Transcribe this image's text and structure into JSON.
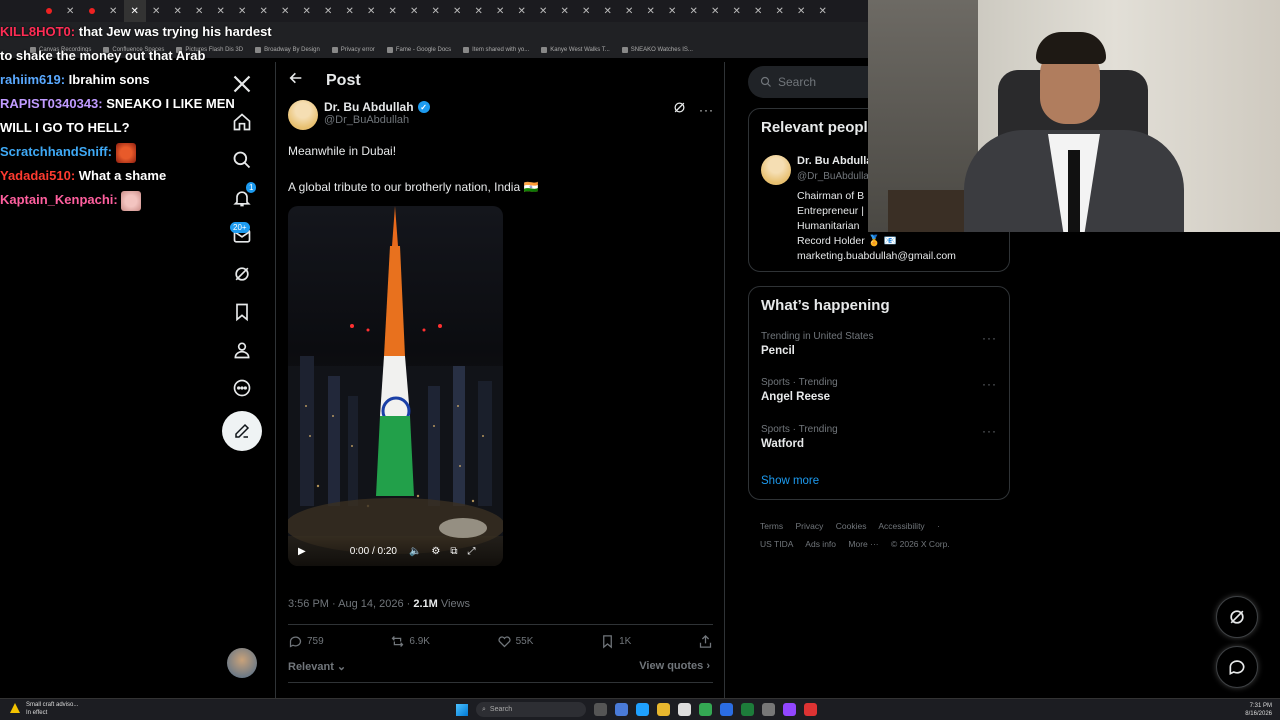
{
  "browser": {
    "bookmarks": [
      "Canvas Recordings",
      "Confluence Spaces",
      "Pictures Flash Dis 3D",
      "Broadway By Design",
      "Privacy error",
      "Fame - Google Docs",
      "Item shared with yo...",
      "Kanye West Walks T...",
      "SNEAKO Watches IS..."
    ]
  },
  "chat": [
    {
      "user": "KILL8HOT0:",
      "message": "that Jew was trying his hardest to shake the money out that Arab",
      "color": "#ff2d55"
    },
    {
      "user": "rahiim619:",
      "message": "Ibrahim sons",
      "color": "#5aa9ff"
    },
    {
      "user": "RAPIST0340343:",
      "message": "SNEAKO I LIKE MEN WILL I GO TO HELL?",
      "color": "#c09bff"
    },
    {
      "user": "ScratchhandSniff:",
      "message": "",
      "color": "#3fa9f5"
    },
    {
      "user": "Yadadai510:",
      "message": "What a shame",
      "color": "#ff3b30"
    },
    {
      "user": "Kaptain_Kenpachi:",
      "message": "",
      "color": "#ff5f9e"
    }
  ],
  "nav": {
    "messages_badge": "20+",
    "notifications_badge": "1"
  },
  "post": {
    "header_title": "Post",
    "author_name": "Dr. Bu Abdullah",
    "author_handle": "@Dr_BuAbdullah",
    "text_line1": "Meanwhile in Dubai!",
    "text_line2": "A global tribute to our brotherly nation, India 🇮🇳",
    "video_time": "0:00 / 0:20",
    "timestamp": "3:56 PM · Aug 14, 2026 · ",
    "views_count": "2.1M",
    "views_label": " Views",
    "replies": "759",
    "reposts": "6.9K",
    "likes": "55K",
    "bookmarks": "1K",
    "sort_label": "Relevant",
    "view_quotes": "View quotes"
  },
  "sidebar": {
    "search_placeholder": "Search",
    "relevant_title": "Relevant people",
    "person_name": "Dr. Bu Abdullah",
    "person_handle": "@Dr_BuAbdullah",
    "bio_lines": [
      "Chairman of B",
      "Entrepreneur |",
      "Humanitarian",
      "Record Holder 🏅 📧",
      "marketing.buabdullah@gmail.com"
    ],
    "happening_title": "What’s happening",
    "trends": [
      {
        "category": "Trending in United States",
        "term": "Pencil"
      },
      {
        "category": "Sports · Trending",
        "term": "Angel Reese"
      },
      {
        "category": "Sports · Trending",
        "term": "Watford"
      }
    ],
    "show_more": "Show more",
    "footer_row1": [
      "Terms",
      "Privacy",
      "Cookies",
      "Accessibility",
      "·"
    ],
    "footer_row2": [
      "US TIDA",
      "Ads info",
      "More ···",
      "© 2026 X Corp."
    ]
  },
  "taskbar": {
    "weather_line1": "Small craft adviso...",
    "weather_line2": "In effect",
    "search_label": "Search",
    "time": "7:31 PM",
    "date": "8/16/2026"
  },
  "colors": {
    "accent": "#1d9bf0",
    "background": "#000000",
    "border": "#2f3336",
    "muted": "#71767b"
  }
}
